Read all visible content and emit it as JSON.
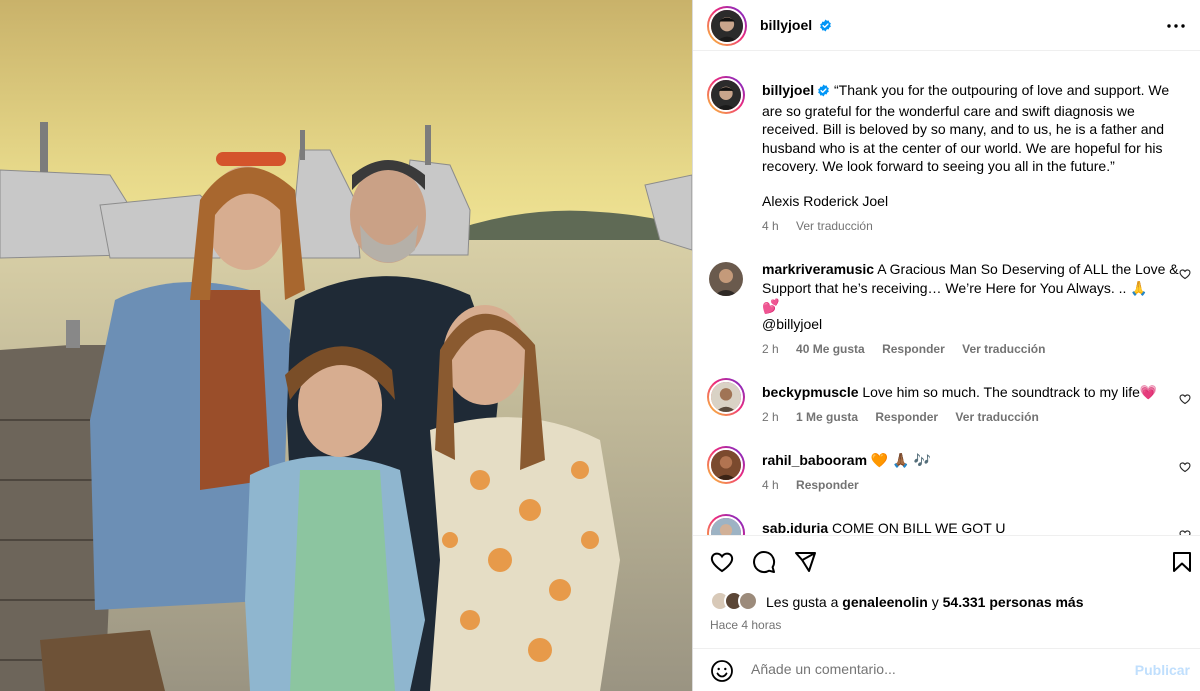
{
  "post": {
    "author": "billyjoel",
    "verified": true,
    "caption_username": "billyjoel",
    "caption": "“Thank you for the outpouring of love and support.  We are so grateful for the wonderful care and swift diagnosis we received.  Bill is beloved by so many, and to us, he is a father and husband who is at the center of our world. We are hopeful for his recovery. We look forward to seeing you all in the future.”",
    "signature": "Alexis Roderick Joel",
    "caption_time": "4 h",
    "translate_label": "Ver traducción",
    "more_icon": "more-horizontal-icon"
  },
  "comments": [
    {
      "username": "markriveramusic",
      "text": "A Gracious Man So Deserving of ALL the Love & Support that he’s receiving… We’re Here for You Always. .. 🙏",
      "text2": "💕",
      "mention": "@billyjoel",
      "time": "2 h",
      "likes": "40 Me gusta",
      "reply": "Responder",
      "translate": "Ver traducción"
    },
    {
      "username": "beckypmuscle",
      "text": "Love him so much. The soundtrack to my life💗",
      "time": "2 h",
      "likes": "1 Me gusta",
      "reply": "Responder",
      "translate": "Ver traducción"
    },
    {
      "username": "rahil_babooram",
      "text": "🧡 🙏🏾 🎶",
      "time": "4 h",
      "reply": "Responder"
    },
    {
      "username": "sab.iduria",
      "text": "COME ON BILL WE GOT U"
    }
  ],
  "actions": {
    "like_icon": "heart-icon",
    "comment_icon": "comment-icon",
    "share_icon": "send-icon",
    "save_icon": "bookmark-icon"
  },
  "likes": {
    "prefix": "Les gusta a",
    "user": "genaleenolin",
    "connector": "y",
    "count": "54.331 personas más"
  },
  "posted_ago": "Hace 4 horas",
  "add_comment": {
    "placeholder": "Añade un comentario...",
    "post_label": "Publicar",
    "emoji_icon": "smiley-icon"
  },
  "colors": {
    "link": "#00376b",
    "muted": "#737373",
    "verified": "#0095f6",
    "post_disabled": "#c0dffd"
  }
}
